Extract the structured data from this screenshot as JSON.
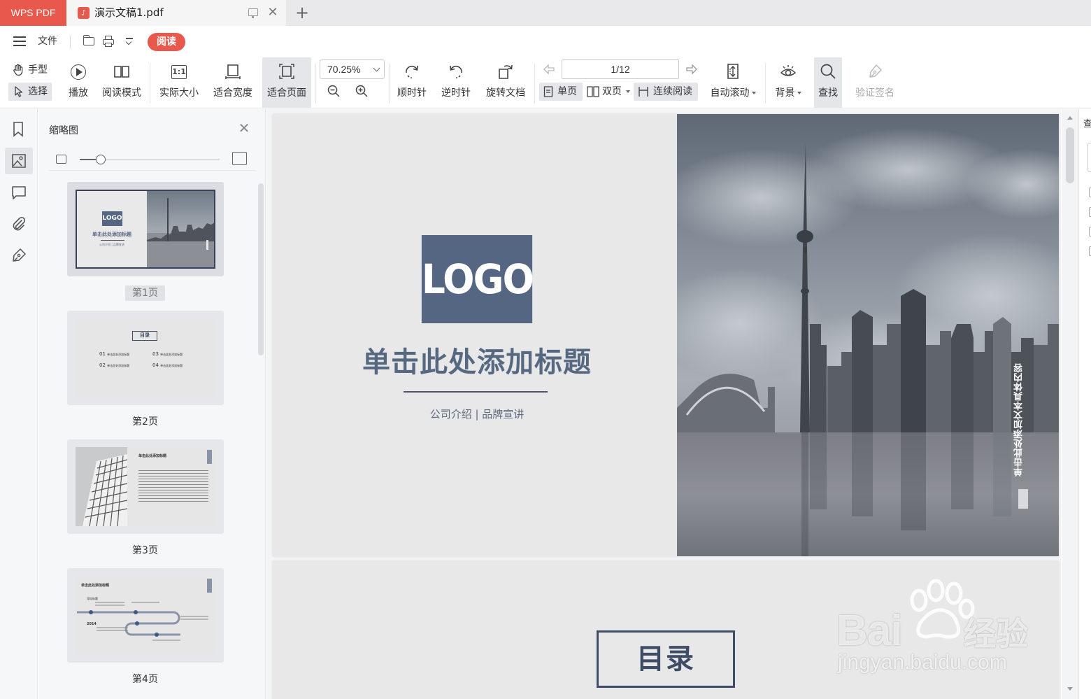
{
  "tabs": {
    "app_label": "WPS PDF",
    "document": {
      "title": "演示文稿1.pdf",
      "close": "✕"
    },
    "new_tab": "+"
  },
  "menu": {
    "file": "文件",
    "read_mode": "阅读"
  },
  "toolbar": {
    "hand": "手型",
    "select": "选择",
    "play": "播放",
    "read_mode": "阅读模式",
    "actual_size": "实际大小",
    "actual_size_icon": "1:1",
    "fit_width": "适合宽度",
    "fit_page": "适合页面",
    "zoom": "70.25%",
    "rotate_cw": "顺时针",
    "rotate_ccw": "逆时针",
    "rotate_doc": "旋转文档",
    "page_indicator": "1/12",
    "single_page": "单页",
    "double_page": "双页",
    "continuous": "连续阅读",
    "auto_scroll": "自动滚动",
    "background": "背景",
    "find": "查找",
    "verify_sign": "验证签名"
  },
  "thumbnails": {
    "title": "缩略图",
    "zoom_fraction": 0.15,
    "pages": [
      {
        "label": "第1页",
        "active": true
      },
      {
        "label": "第2页",
        "active": false
      },
      {
        "label": "第3页",
        "active": false
      },
      {
        "label": "第4页",
        "active": false
      }
    ],
    "p1": {
      "logo": "LOGO",
      "title": "单击此处添加标题",
      "sub": "公司介绍 | 品牌宣讲"
    },
    "p2": {
      "heading": "目录",
      "items": [
        {
          "no": "01",
          "text": "单击此处添加标题"
        },
        {
          "no": "02",
          "text": "单击此处添加标题"
        },
        {
          "no": "03",
          "text": "单击此处添加标题"
        },
        {
          "no": "04",
          "text": "单击此处添加标题"
        }
      ]
    },
    "p3": {
      "title": "单击此处添加标题"
    },
    "p4": {
      "title": "单击此处添加标题",
      "year": "2014",
      "label": "添加标题"
    }
  },
  "page1": {
    "logo": "LOGO",
    "title": "单击此处添加标题",
    "subtitle": "公司介绍 | 品牌宣讲",
    "vertical_text": "单击此处添加文本具体内容"
  },
  "page2": {
    "heading": "目录"
  },
  "right_panel": {
    "title": "查"
  },
  "watermark": {
    "brand": "Bai",
    "brand_cn": "经验",
    "url": "jingyan.baidu.com"
  },
  "colors": {
    "accent": "#e8584d",
    "logo_bg": "#546681",
    "title_text": "#576881"
  }
}
